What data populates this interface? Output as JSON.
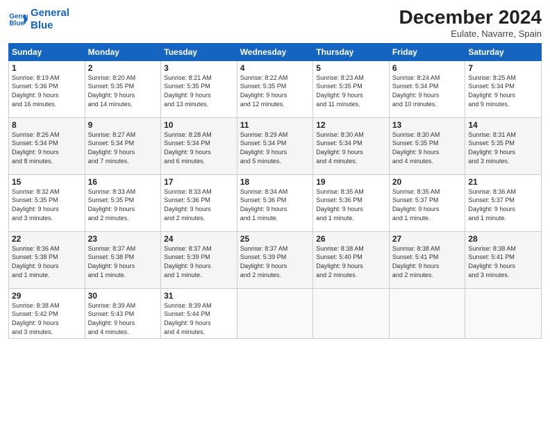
{
  "header": {
    "logo_line1": "General",
    "logo_line2": "Blue",
    "month": "December 2024",
    "location": "Eulate, Navarre, Spain"
  },
  "weekdays": [
    "Sunday",
    "Monday",
    "Tuesday",
    "Wednesday",
    "Thursday",
    "Friday",
    "Saturday"
  ],
  "weeks": [
    [
      {
        "day": "1",
        "info": "Sunrise: 8:19 AM\nSunset: 5:36 PM\nDaylight: 9 hours\nand 16 minutes."
      },
      {
        "day": "2",
        "info": "Sunrise: 8:20 AM\nSunset: 5:35 PM\nDaylight: 9 hours\nand 14 minutes."
      },
      {
        "day": "3",
        "info": "Sunrise: 8:21 AM\nSunset: 5:35 PM\nDaylight: 9 hours\nand 13 minutes."
      },
      {
        "day": "4",
        "info": "Sunrise: 8:22 AM\nSunset: 5:35 PM\nDaylight: 9 hours\nand 12 minutes."
      },
      {
        "day": "5",
        "info": "Sunrise: 8:23 AM\nSunset: 5:35 PM\nDaylight: 9 hours\nand 11 minutes."
      },
      {
        "day": "6",
        "info": "Sunrise: 8:24 AM\nSunset: 5:34 PM\nDaylight: 9 hours\nand 10 minutes."
      },
      {
        "day": "7",
        "info": "Sunrise: 8:25 AM\nSunset: 5:34 PM\nDaylight: 9 hours\nand 9 minutes."
      }
    ],
    [
      {
        "day": "8",
        "info": "Sunrise: 8:26 AM\nSunset: 5:34 PM\nDaylight: 9 hours\nand 8 minutes."
      },
      {
        "day": "9",
        "info": "Sunrise: 8:27 AM\nSunset: 5:34 PM\nDaylight: 9 hours\nand 7 minutes."
      },
      {
        "day": "10",
        "info": "Sunrise: 8:28 AM\nSunset: 5:34 PM\nDaylight: 9 hours\nand 6 minutes."
      },
      {
        "day": "11",
        "info": "Sunrise: 8:29 AM\nSunset: 5:34 PM\nDaylight: 9 hours\nand 5 minutes."
      },
      {
        "day": "12",
        "info": "Sunrise: 8:30 AM\nSunset: 5:34 PM\nDaylight: 9 hours\nand 4 minutes."
      },
      {
        "day": "13",
        "info": "Sunrise: 8:30 AM\nSunset: 5:35 PM\nDaylight: 9 hours\nand 4 minutes."
      },
      {
        "day": "14",
        "info": "Sunrise: 8:31 AM\nSunset: 5:35 PM\nDaylight: 9 hours\nand 3 minutes."
      }
    ],
    [
      {
        "day": "15",
        "info": "Sunrise: 8:32 AM\nSunset: 5:35 PM\nDaylight: 9 hours\nand 3 minutes."
      },
      {
        "day": "16",
        "info": "Sunrise: 8:33 AM\nSunset: 5:35 PM\nDaylight: 9 hours\nand 2 minutes."
      },
      {
        "day": "17",
        "info": "Sunrise: 8:33 AM\nSunset: 5:36 PM\nDaylight: 9 hours\nand 2 minutes."
      },
      {
        "day": "18",
        "info": "Sunrise: 8:34 AM\nSunset: 5:36 PM\nDaylight: 9 hours\nand 1 minute."
      },
      {
        "day": "19",
        "info": "Sunrise: 8:35 AM\nSunset: 5:36 PM\nDaylight: 9 hours\nand 1 minute."
      },
      {
        "day": "20",
        "info": "Sunrise: 8:35 AM\nSunset: 5:37 PM\nDaylight: 9 hours\nand 1 minute."
      },
      {
        "day": "21",
        "info": "Sunrise: 8:36 AM\nSunset: 5:37 PM\nDaylight: 9 hours\nand 1 minute."
      }
    ],
    [
      {
        "day": "22",
        "info": "Sunrise: 8:36 AM\nSunset: 5:38 PM\nDaylight: 9 hours\nand 1 minute."
      },
      {
        "day": "23",
        "info": "Sunrise: 8:37 AM\nSunset: 5:38 PM\nDaylight: 9 hours\nand 1 minute."
      },
      {
        "day": "24",
        "info": "Sunrise: 8:37 AM\nSunset: 5:39 PM\nDaylight: 9 hours\nand 1 minute."
      },
      {
        "day": "25",
        "info": "Sunrise: 8:37 AM\nSunset: 5:39 PM\nDaylight: 9 hours\nand 2 minutes."
      },
      {
        "day": "26",
        "info": "Sunrise: 8:38 AM\nSunset: 5:40 PM\nDaylight: 9 hours\nand 2 minutes."
      },
      {
        "day": "27",
        "info": "Sunrise: 8:38 AM\nSunset: 5:41 PM\nDaylight: 9 hours\nand 2 minutes."
      },
      {
        "day": "28",
        "info": "Sunrise: 8:38 AM\nSunset: 5:41 PM\nDaylight: 9 hours\nand 3 minutes."
      }
    ],
    [
      {
        "day": "29",
        "info": "Sunrise: 8:38 AM\nSunset: 5:42 PM\nDaylight: 9 hours\nand 3 minutes."
      },
      {
        "day": "30",
        "info": "Sunrise: 8:39 AM\nSunset: 5:43 PM\nDaylight: 9 hours\nand 4 minutes."
      },
      {
        "day": "31",
        "info": "Sunrise: 8:39 AM\nSunset: 5:44 PM\nDaylight: 9 hours\nand 4 minutes."
      },
      {
        "day": "",
        "info": ""
      },
      {
        "day": "",
        "info": ""
      },
      {
        "day": "",
        "info": ""
      },
      {
        "day": "",
        "info": ""
      }
    ]
  ]
}
